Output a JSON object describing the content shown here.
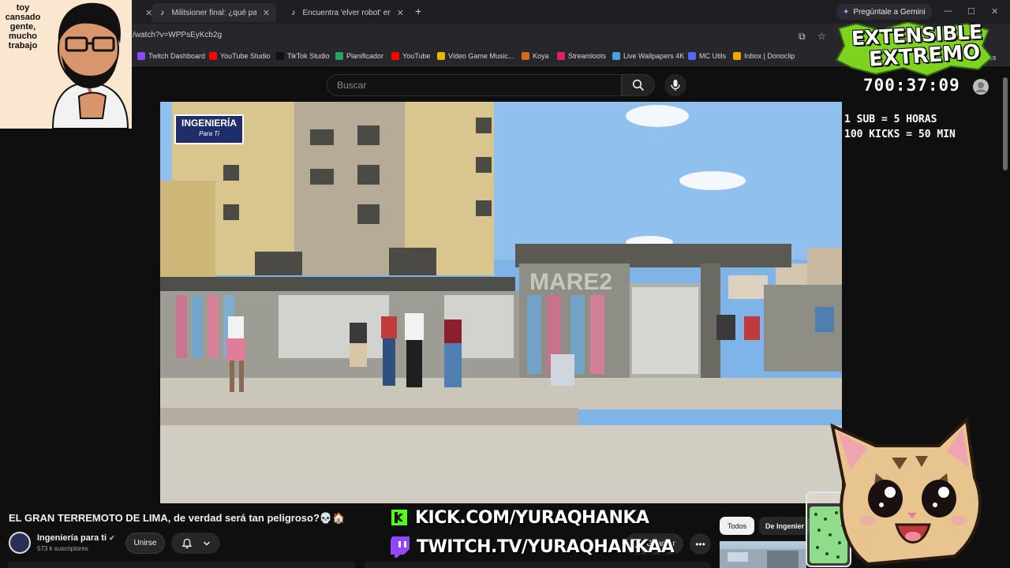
{
  "browser": {
    "tabs": [
      {
        "label": "Militsioner final: ¿qué pasa si u"
      },
      {
        "label": "Encuentra 'elver robot' en TikTo"
      }
    ],
    "gemini_button": "Pregúntale a Gemini",
    "url": "/watch?v=WPPsEyKcb2g",
    "bookmarks": [
      {
        "label": "Twitch Dashboard",
        "color": "#9146ff"
      },
      {
        "label": "YouTube Studio",
        "color": "#ff0000"
      },
      {
        "label": "TikTok Studio",
        "color": "#111111"
      },
      {
        "label": "Planificador",
        "color": "#1fa463"
      },
      {
        "label": "YouTube",
        "color": "#ff0000"
      },
      {
        "label": "Video Game Music...",
        "color": "#e6b800"
      },
      {
        "label": "Koya",
        "color": "#d2691e"
      },
      {
        "label": "Streamloots",
        "color": "#e0245e"
      },
      {
        "label": "Live Wallpapers 4K",
        "color": "#4aa3df"
      },
      {
        "label": "MC Utils",
        "color": "#5865f2"
      },
      {
        "label": "Inbox | Donoclip",
        "color": "#f0a500"
      }
    ],
    "bookmarks_more": "voritos"
  },
  "youtube": {
    "search": {
      "placeholder": "Buscar"
    },
    "video_title": "EL GRAN TERREMOTO DE LIMA, de verdad será tan peligroso?💀🏠",
    "channel": {
      "name": "Ingeniería para ti",
      "subscribers": "573 k suscriptores"
    },
    "join_label": "Unirse",
    "save_label": "Guardar",
    "chips": [
      {
        "label": "Todos"
      },
      {
        "label": "De Ingenier"
      }
    ],
    "video_logo": {
      "line1": "INGENIERÍA",
      "line2": "Para Ti"
    },
    "wall_sign": "MARE2"
  },
  "overlay": {
    "webcam_note": "toy cansado gente, mucho trabajo",
    "logo_line1": "EXTENSIBLE",
    "logo_line2": "EXTREMO",
    "timer": "700:37:09",
    "rules": [
      "1 SUB = 5 HORAS",
      "100 KICKS = 50 MIN"
    ],
    "kick_url": "KICK.COM/YURAQHANKA",
    "twitch_url": "TWITCH.TV/YURAQHANKAA"
  },
  "colors": {
    "kick": "#53fc18",
    "twitch": "#9146ff",
    "logo_green": "#7ed321"
  }
}
